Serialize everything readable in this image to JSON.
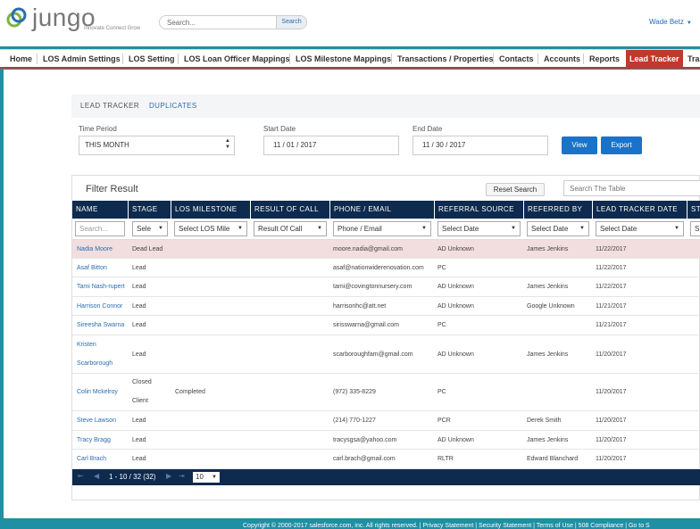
{
  "header": {
    "logo_text": "jungo",
    "logo_tagline": "Innovate Connect Grow",
    "search_placeholder": "Search...",
    "search_button": "Search",
    "user_name": "Wade Betz"
  },
  "nav": {
    "items": [
      {
        "label": "Home"
      },
      {
        "label": "LOS Admin Settings"
      },
      {
        "label": "LOS Setting"
      },
      {
        "label": "LOS Loan Officer Mappings"
      },
      {
        "label": "LOS Milestone Mappings"
      },
      {
        "label": "Transactions / Properties"
      },
      {
        "label": "Contacts"
      },
      {
        "label": "Accounts"
      },
      {
        "label": "Reports"
      },
      {
        "label": "Lead Tracker"
      },
      {
        "label": "Tra"
      }
    ],
    "active": "Lead Tracker"
  },
  "subtabs": {
    "lead_tracker": "LEAD TRACKER",
    "duplicates": "DUPLICATES"
  },
  "filters": {
    "time_period_label": "Time Period",
    "time_period_value": "THIS MONTH",
    "start_date_label": "Start Date",
    "start_date_value": "11 / 01 / 2017",
    "end_date_label": "End Date",
    "end_date_value": "11 / 30 / 2017",
    "view_button": "View",
    "export_button": "Export"
  },
  "panel": {
    "title": "Filter Result",
    "reset_button": "Reset Search",
    "table_search_placeholder": "Search The Table"
  },
  "table": {
    "columns": [
      "NAME",
      "STAGE",
      "LOS MILESTONE",
      "RESULT OF CALL",
      "PHONE / EMAIL",
      "REFERRAL SOURCE",
      "REFERRED BY",
      "LEAD TRACKER DATE",
      "ST"
    ],
    "filter_row": [
      "Search...",
      "Sele",
      "Select LOS Mile",
      "Result Of Call",
      "Phone / Email",
      "Select Date",
      "Select Date",
      "Select Date",
      "S"
    ],
    "rows": [
      {
        "name": "Nadia Moore",
        "name2": "",
        "stage": "Dead Lead",
        "stage2": "",
        "milestone": "",
        "result": "",
        "contact": "moore.nadia@gmail.com",
        "referral": "AD Unknown",
        "referred_by": "James Jenkins",
        "date": "11/22/2017"
      },
      {
        "name": "Asaf Bitton",
        "name2": "",
        "stage": "Lead",
        "stage2": "",
        "milestone": "",
        "result": "",
        "contact": "asaf@nationwiderenovation.com",
        "referral": "PC",
        "referred_by": "",
        "date": "11/22/2017"
      },
      {
        "name": "Tami Nash-rupert",
        "name2": "",
        "stage": "Lead",
        "stage2": "",
        "milestone": "",
        "result": "",
        "contact": "tami@covingtonnursery.com",
        "referral": "AD Unknown",
        "referred_by": "James Jenkins",
        "date": "11/22/2017"
      },
      {
        "name": "Harrison Connor",
        "name2": "",
        "stage": "Lead",
        "stage2": "",
        "milestone": "",
        "result": "",
        "contact": "harrisonhc@att.net",
        "referral": "AD Unknown",
        "referred_by": "Google Unknown",
        "date": "11/21/2017"
      },
      {
        "name": "Sireesha Swarna",
        "name2": "",
        "stage": "Lead",
        "stage2": "",
        "milestone": "",
        "result": "",
        "contact": "sirisswarna@gmail.com",
        "referral": "PC",
        "referred_by": "",
        "date": "11/21/2017"
      },
      {
        "name": "Kristen",
        "name2": "Scarborough",
        "stage": "Lead",
        "stage2": "",
        "milestone": "",
        "result": "",
        "contact": "scarboroughfam@gmail.com",
        "referral": "AD Unknown",
        "referred_by": "James Jenkins",
        "date": "11/20/2017"
      },
      {
        "name": "Colin Mckelroy",
        "name2": "",
        "stage": "Closed",
        "stage2": "Client",
        "milestone": "Completed",
        "result": "",
        "contact": "(972) 335-8229",
        "referral": "PC",
        "referred_by": "",
        "date": "11/20/2017"
      },
      {
        "name": "Steve Lawson",
        "name2": "",
        "stage": "Lead",
        "stage2": "",
        "milestone": "",
        "result": "",
        "contact": "(214) 770-1227",
        "referral": "PCR",
        "referred_by": "Derek Smith",
        "date": "11/20/2017"
      },
      {
        "name": "Tracy Bragg",
        "name2": "",
        "stage": "Lead",
        "stage2": "",
        "milestone": "",
        "result": "",
        "contact": "tracysgsa@yahoo.com",
        "referral": "AD Unknown",
        "referred_by": "James Jenkins",
        "date": "11/20/2017"
      },
      {
        "name": "Carl Brach",
        "name2": "",
        "stage": "Lead",
        "stage2": "",
        "milestone": "",
        "result": "",
        "contact": "carl.brach@gmail.com",
        "referral": "RLTR",
        "referred_by": "Edward Blanchard",
        "date": "11/20/2017"
      }
    ]
  },
  "pager": {
    "range": "1 - 10 / 32 (32)",
    "page_size": "10"
  },
  "footer": {
    "text": "Copyright © 2000-2017 salesforce.com, inc. All rights reserved. | Privacy Statement | Security Statement | Terms of Use | 508 Compliance | Go to S"
  },
  "colors": {
    "brand_teal": "#1f8fa3",
    "nav_active": "#c0392b",
    "table_header": "#0e2a4e",
    "button_blue": "#1a73c8",
    "link_blue": "#2a6db0",
    "highlight_row": "#f2dede"
  }
}
